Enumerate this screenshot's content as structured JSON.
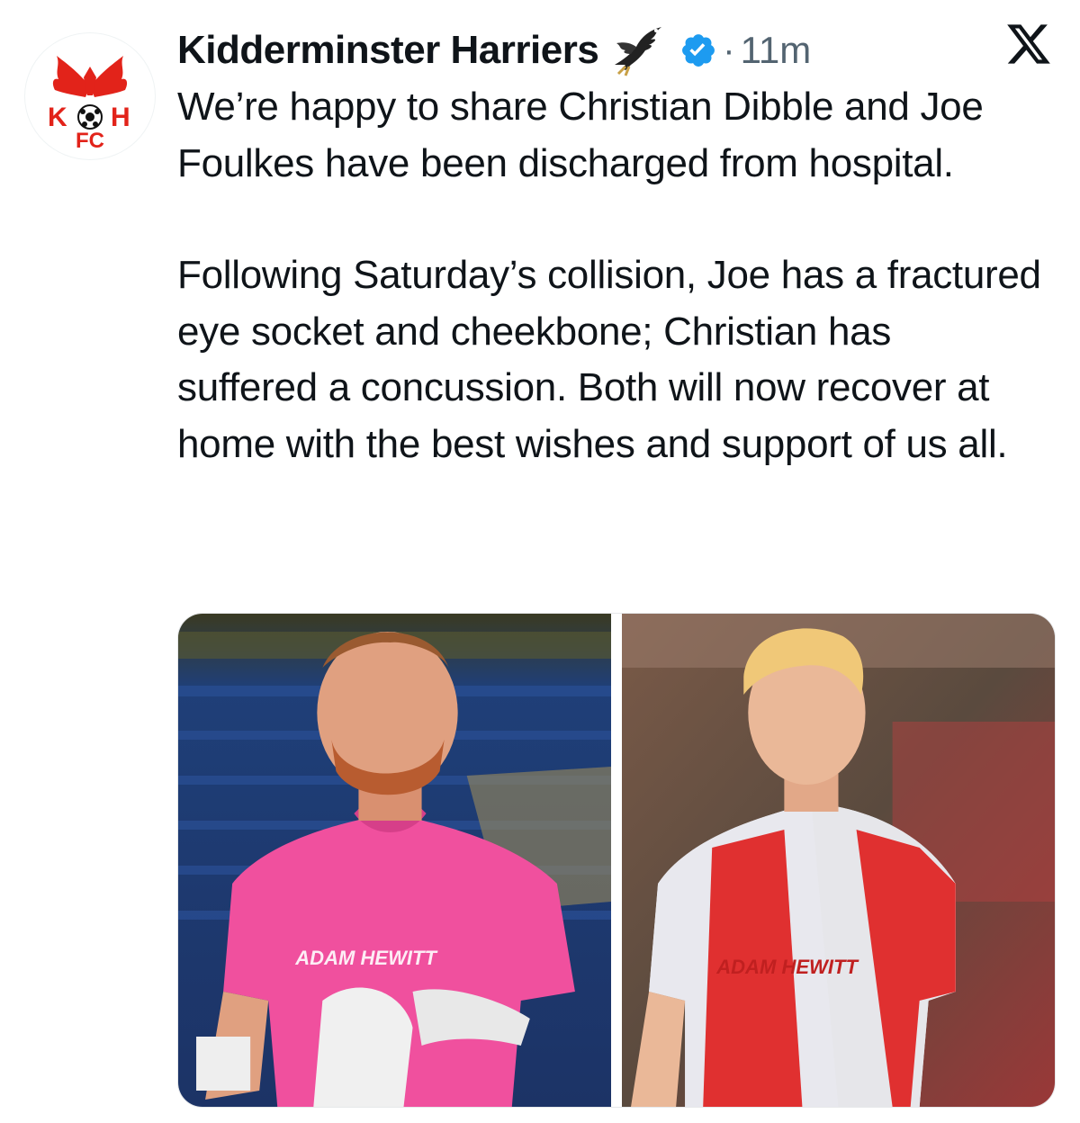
{
  "tweet": {
    "display_name": "Kidderminster Harriers",
    "separator": "·",
    "time": "11m",
    "paragraphs": [
      "We’re happy to share Christian Dibble and Joe Foulkes have been discharged from hospital.",
      "Following Saturday’s collision, Joe has a fractured eye socket and cheekbone; Christian has suffered a concussion. Both will now recover at home with the best wishes and support of us all."
    ],
    "avatar_text": {
      "line1": "KH",
      "line2": "FC"
    }
  },
  "icons": {
    "avatar": "club-crest-icon",
    "name_emoji": "eagle-icon",
    "verified": "verified-badge-icon",
    "platform": "x-logo-icon"
  },
  "colors": {
    "verified_blue": "#1d9bf0",
    "crest_red": "#e2231a",
    "muted_text": "#536471"
  },
  "media": [
    {
      "name": "goalkeeper-photo",
      "shirt_text": "ADAM HEWITT"
    },
    {
      "name": "outfield-player-photo",
      "shirt_text": "ADAM HEWITT"
    }
  ]
}
